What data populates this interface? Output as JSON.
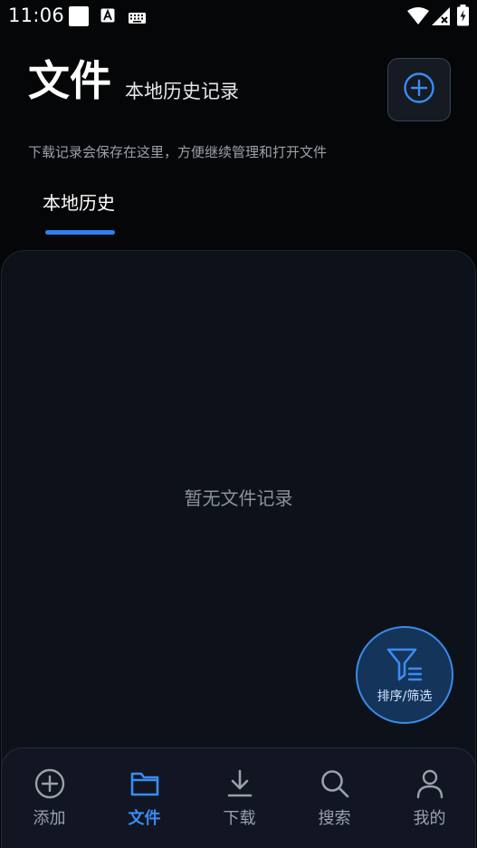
{
  "status_bar": {
    "time": "11:06",
    "icons": [
      "square-notification-icon",
      "a-notification-icon",
      "keyboard-icon",
      "wifi-icon",
      "signal-icon",
      "battery-icon"
    ]
  },
  "header": {
    "title": "文件",
    "subtitle": "本地历史记录",
    "hint": "下载记录会保存在这里，方便继续管理和打开文件"
  },
  "tabs": [
    {
      "label": "本地历史",
      "active": true
    }
  ],
  "content": {
    "empty_message": "暂无文件记录"
  },
  "filter_button": {
    "label": "排序/筛选",
    "icon": "filter-icon"
  },
  "bottom_nav": [
    {
      "label": "添加",
      "icon": "add-circle-icon",
      "active": false
    },
    {
      "label": "文件",
      "icon": "folder-icon",
      "active": true
    },
    {
      "label": "下载",
      "icon": "download-icon",
      "active": false
    },
    {
      "label": "搜索",
      "icon": "search-icon",
      "active": false
    },
    {
      "label": "我的",
      "icon": "person-icon",
      "active": false
    }
  ],
  "colors": {
    "background": "#050608",
    "panel": "#0d111a",
    "accent": "#2f7ff0",
    "nav_inactive": "#9aa1ab"
  }
}
